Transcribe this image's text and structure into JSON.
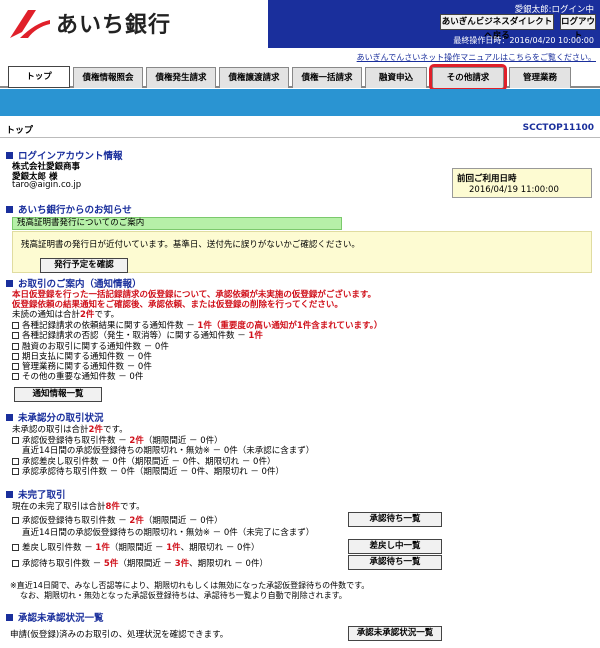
{
  "header": {
    "bank_name": "あいち銀行",
    "user_name": "愛銀太郎:ログイン中",
    "direct_button": "あいぎんビジネスダイレクトへ戻る",
    "logout_button": "ログアウト",
    "last_operation": "最終操作日時：2016/04/20 10:00:00",
    "manual_link": "あいぎんでんさいネット操作マニュアルはこちらをご覧ください。"
  },
  "tabs": [
    "トップ",
    "債権情報照会",
    "債権発生請求",
    "債権譲渡請求",
    "債権一括請求",
    "融資申込",
    "その他請求",
    "管理業務"
  ],
  "page": {
    "title": "トップ",
    "id": "SCCTOP11100"
  },
  "login_info": {
    "heading": "ログインアカウント情報",
    "company": "株式会社愛銀商事",
    "user": "愛銀太郎 様",
    "email": "taro@aigin.co.jp",
    "last_use_label": "前回ご利用日時",
    "last_use_value": "2016/04/19 11:00:00"
  },
  "announcement": {
    "heading": "あいち銀行からのお知らせ",
    "notice_title": "残高証明書発行についてのご案内",
    "notice_message": "残高証明書の発行日が近付いています。基準日、送付先に誤りがないかご確認ください。",
    "button": "発行予定を確認"
  },
  "notifications": {
    "heading": "お取引のご案内（通知情報）",
    "warning1": "本日仮登録を行った一括記録請求の仮登録について、承認依頼が未実施の仮登録がございます。",
    "warning2": "仮登録依頼の結果通知をご確認後、承認依頼、または仮登録の削除を行ってください。",
    "unread_prefix": "未読の通知は合計",
    "unread_count": "2件",
    "unread_suffix": "です。",
    "items": [
      {
        "label": "各種記録請求の依頼結果に関する通知件数 － ",
        "count": "1件",
        "note": "（重要度の高い通知が1件含まれています。）"
      },
      {
        "label": "各種記録請求の否認（発生・取消等）に関する通知件数 － ",
        "count": "1件",
        "note": ""
      },
      {
        "label": "融資のお取引に関する通知件数 － 0件",
        "count": "",
        "note": ""
      },
      {
        "label": "期日支払に関する通知件数 － 0件",
        "count": "",
        "note": ""
      },
      {
        "label": "管理業務に関する通知件数 － 0件",
        "count": "",
        "note": ""
      },
      {
        "label": "その他の重要な通知件数 － 0件",
        "count": "",
        "note": ""
      }
    ],
    "button": "通知情報一覧"
  },
  "pending_approval": {
    "heading": "未承認分の取引状況",
    "total_prefix": "未承認の取引は合計",
    "total_count": "2件",
    "total_suffix": "です。",
    "line1_a": "承認仮登録待ち取引件数 － ",
    "line1_count": "2件",
    "line1_b": "（期限間近 － 0件）",
    "line2": "直近14日間の承認仮登録待ちの期限切れ・無効※ － 0件（未承認に含まず）",
    "line3": "承認差戻し取引件数 － 0件（期限間近 － 0件、期限切れ － 0件）",
    "line4": "承認承認待ち取引件数 － 0件（期限間近 － 0件、期限切れ － 0件）"
  },
  "incomplete": {
    "heading": "未完了取引",
    "total_prefix": "現在の未完了取引は合計",
    "total_count": "8件",
    "total_suffix": "です。",
    "line1_a": "承認仮登録待ち取引件数 － ",
    "line1_count": "2件",
    "line1_b": "（期限間近 － 0件）",
    "line2": "直近14日間の承認仮登録待ちの期限切れ・無効※ － 0件（未完了に含まず）",
    "line3_a": "差戻し取引件数 － ",
    "line3_count": "1件",
    "line3_b": "（期限間近 － ",
    "line3_count2": "1件",
    "line3_c": "、期限切れ － 0件）",
    "line4_a": "承認待ち取引件数 － ",
    "line4_count": "5件",
    "line4_b": "（期限間近 － ",
    "line4_count2": "3件",
    "line4_c": "、期限切れ － 0件）",
    "button_pending": "承認待ち一覧",
    "button_returned": "差戻し中一覧",
    "button_waiting": "承認待ち一覧",
    "footnote1": "※直近14日間で、みなし否認等により、期限切れもしくは無効になった承認仮登録待ちの件数です。",
    "footnote2": "なお、期限切れ・無効となった承認仮登録待ちは、承認待ち一覧より自動で削除されます。"
  },
  "approval_status": {
    "heading": "承認未承認状況一覧",
    "desc": "申請(仮登録)済みのお取引の、処理状況を確認できます。",
    "button": "承認未承認状況一覧"
  }
}
